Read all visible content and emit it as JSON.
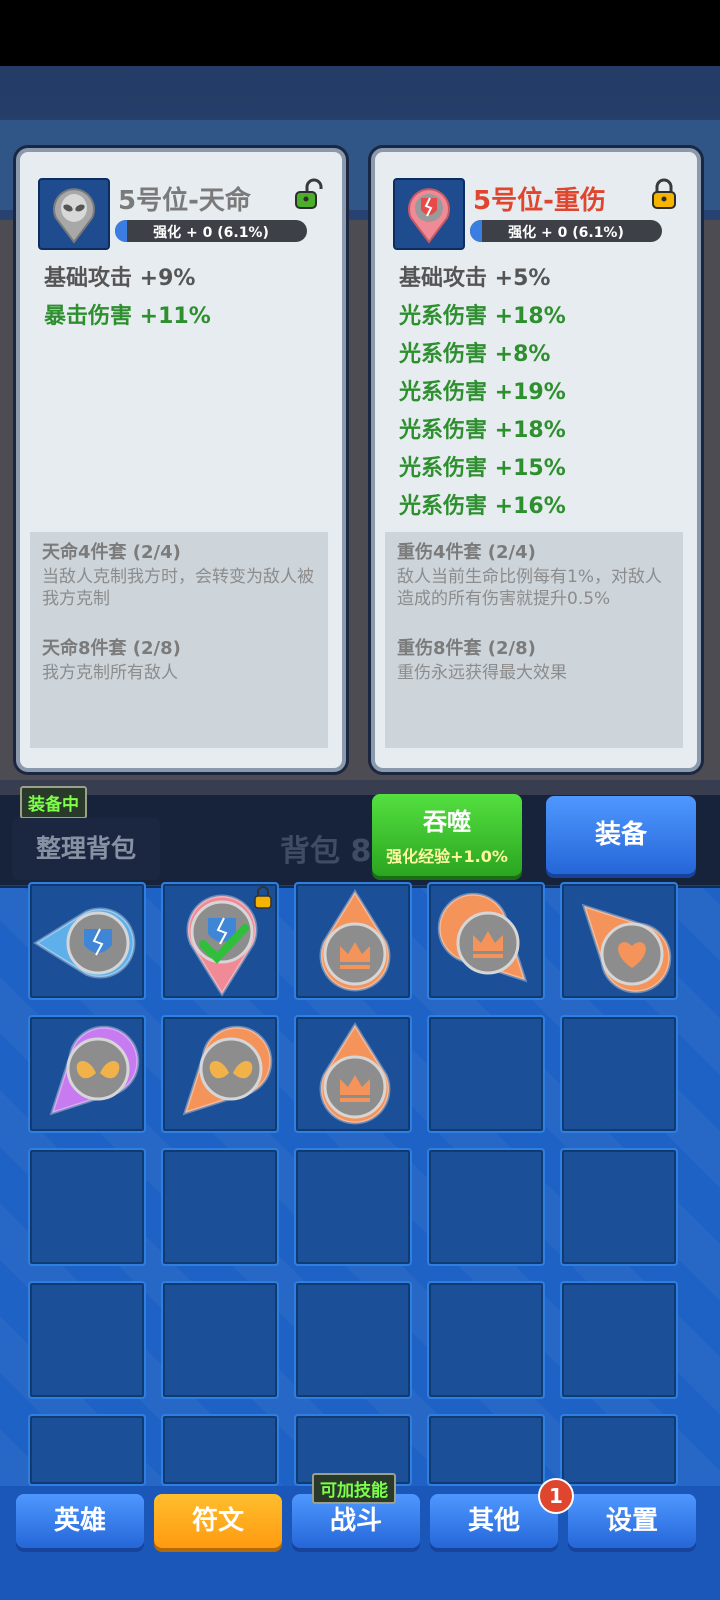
{
  "left_card": {
    "title": "5号位-天命",
    "enhance": "强化 + 0   (6.1%)",
    "stats": [
      {
        "text": "基础攻击 +9%",
        "kind": "base"
      },
      {
        "text": "暴击伤害 +11%",
        "kind": "bonus"
      }
    ],
    "sets": [
      {
        "title": "天命4件套 (2/4)",
        "desc": "当敌人克制我方时，会转变为敌人被我方克制"
      },
      {
        "title": "天命8件套 (2/8)",
        "desc": "我方克制所有敌人"
      }
    ],
    "lock_state": "unlocked",
    "icon": "alien-icon"
  },
  "right_card": {
    "title": "5号位-重伤",
    "enhance": "强化 + 0   (6.1%)",
    "stats": [
      {
        "text": "基础攻击 +5%",
        "kind": "base"
      },
      {
        "text": "光系伤害 +18%",
        "kind": "bonus"
      },
      {
        "text": "光系伤害 +8%",
        "kind": "bonus"
      },
      {
        "text": "光系伤害 +19%",
        "kind": "bonus"
      },
      {
        "text": "光系伤害 +18%",
        "kind": "bonus"
      },
      {
        "text": "光系伤害 +15%",
        "kind": "bonus"
      },
      {
        "text": "光系伤害 +16%",
        "kind": "bonus"
      }
    ],
    "sets": [
      {
        "title": "重伤4件套 (2/4)",
        "desc": "敌人当前生命比例每有1%，对敌人造成的所有伤害就提升0.5%"
      },
      {
        "title": "重伤8件套 (2/8)",
        "desc": "重伤永远获得最大效果"
      }
    ],
    "lock_state": "locked",
    "icon": "broken-shield-icon"
  },
  "equipped_badge": "装备中",
  "sort_button": "整理背包",
  "bag_title": "背包 8",
  "devour_button": {
    "label": "吞噬",
    "sub": "强化经验+1.0%"
  },
  "equip_button": "装备",
  "inventory": [
    {
      "icon": "broken-shield-icon",
      "color": "#5fb0ea",
      "pointer": "left"
    },
    {
      "icon": "broken-shield-icon",
      "color": "#f08a96",
      "pointer": "down",
      "selected": true,
      "locked": true
    },
    {
      "icon": "crown-icon",
      "color": "#f4935a",
      "pointer": "up"
    },
    {
      "icon": "crown-icon",
      "color": "#f4935a",
      "pointer": "down-right"
    },
    {
      "icon": "heart-icon",
      "color": "#f4935a",
      "pointer": "up-left"
    },
    {
      "icon": "wings-icon",
      "color": "#c87af0",
      "pointer": "down-left"
    },
    {
      "icon": "wings-icon",
      "color": "#f4935a",
      "pointer": "down-left"
    },
    {
      "icon": "crown-icon",
      "color": "#f4935a",
      "pointer": "up"
    }
  ],
  "nav": [
    {
      "label": "英雄",
      "active": false
    },
    {
      "label": "符文",
      "active": true
    },
    {
      "label": "战斗",
      "active": false
    },
    {
      "label": "其他",
      "active": false
    },
    {
      "label": "设置",
      "active": false
    }
  ],
  "skill_badge": "可加技能",
  "notif_count": "1"
}
